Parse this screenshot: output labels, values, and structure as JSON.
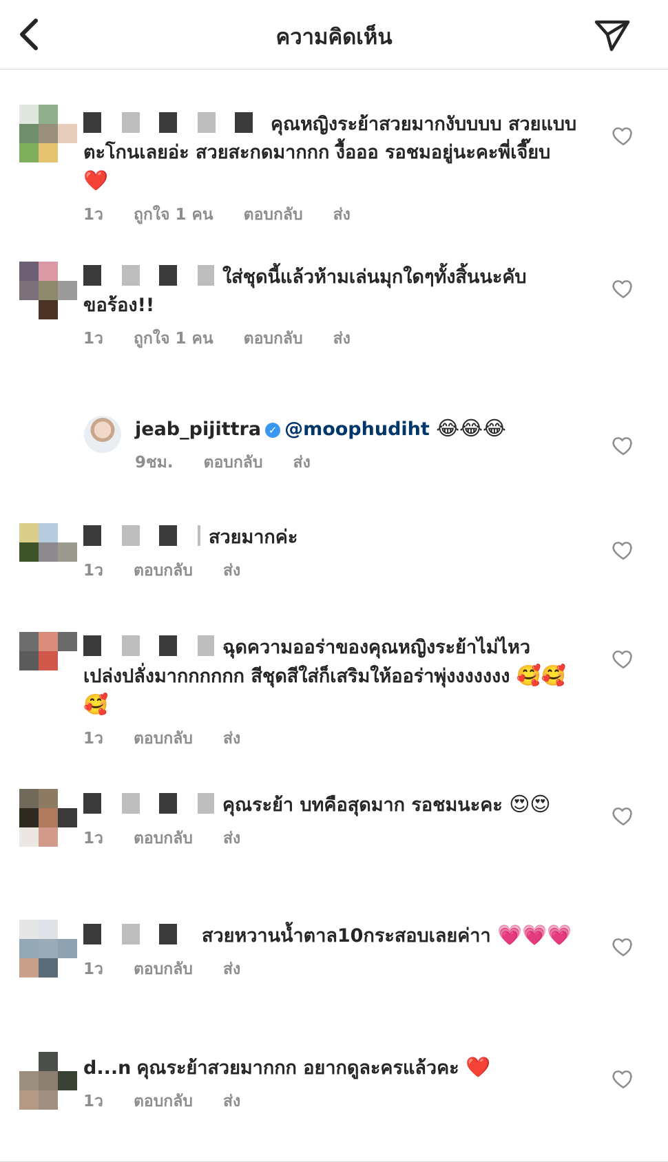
{
  "header": {
    "title": "ความคิดเห็น",
    "back_icon": "chevron-left-icon",
    "send_icon": "paper-plane-icon"
  },
  "colors": {
    "accent_link": "#00376b",
    "verified": "#3897f0",
    "meta_gray": "#8e8e8e",
    "heart_red": "#ed4956"
  },
  "comments": [
    {
      "text": "คุณหญิงระย้าสวยมากงับบบบ สวยแบบตะโกนเลยอ่ะ สวยสะกดมากกก งื้อออ รอชมอยู่นะคะพี่เจี๊ยบ",
      "emoji": "❤️",
      "time": "1ว",
      "likes": "ถูกใจ 1 คน",
      "reply": "ตอบกลับ",
      "send": "ส่ง"
    },
    {
      "text": "ใส่ชุดนี้แล้วห้ามเล่นมุกใดๆทั้งสิ้นนะคับ ขอร้อง!!",
      "time": "1ว",
      "likes": "ถูกใจ 1 คน",
      "reply": "ตอบกลับ",
      "send": "ส่ง"
    },
    {
      "username": "jeab_pijittra",
      "mention": "@moophudiht",
      "emoji": "😂😂😂",
      "time": "9ชม.",
      "reply": "ตอบกลับ",
      "send": "ส่ง"
    },
    {
      "text": "สวยมากค่ะ",
      "time": "1ว",
      "reply": "ตอบกลับ",
      "send": "ส่ง"
    },
    {
      "text": "ฉุดความออร่าของคุณหญิงระย้าไม่ไหว เปล่งปลั่งมากกกกกก สีชุดสีใส่ก็เสริมให้ออร่าพุ่งงงงงงง",
      "emoji": "🥰🥰🥰",
      "time": "1ว",
      "reply": "ตอบกลับ",
      "send": "ส่ง"
    },
    {
      "text": "คุณระย้า บทคือสุดมาก รอชมนะคะ",
      "emoji": "😍😍",
      "time": "1ว",
      "reply": "ตอบกลับ",
      "send": "ส่ง"
    },
    {
      "text": "สวยหวานน้ำตาล10กระสอบเลยค่าา",
      "emoji": "💗💗💗",
      "time": "1ว",
      "reply": "ตอบกลับ",
      "send": "ส่ง"
    },
    {
      "username_visible": "d...n",
      "text": "คุณระย้าสวยมากกก อยากดูละครแล้วคะ",
      "emoji": "❤️",
      "time": "1ว",
      "reply": "ตอบกลับ",
      "send": "ส่ง"
    }
  ]
}
